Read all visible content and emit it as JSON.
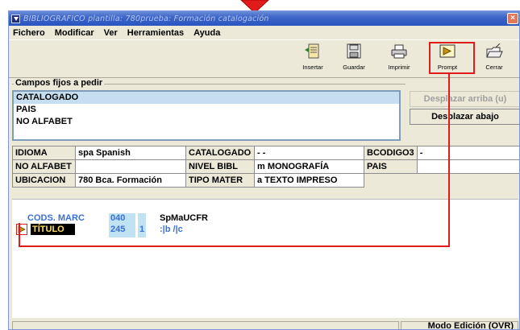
{
  "window": {
    "title": "BIBLIOGRAFICO plantilla: 780prueba: Formación catalogación"
  },
  "menu": [
    "Fichero",
    "Modificar",
    "Ver",
    "Herramientas",
    "Ayuda"
  ],
  "toolbar": {
    "buttons": [
      {
        "label": "Insertar",
        "icon": "insert-icon"
      },
      {
        "label": "Guardar",
        "icon": "save-icon"
      },
      {
        "label": "Imprimir",
        "icon": "print-icon"
      },
      {
        "label": "Prompt",
        "icon": "prompt-icon"
      },
      {
        "label": "Cerrar",
        "icon": "close-folder-icon"
      }
    ]
  },
  "campos": {
    "group_label": "Campos fijos a pedir",
    "items": [
      "CATALOGADO",
      "PAIS",
      "NO ALFABET"
    ],
    "selected": "CATALOGADO",
    "move_up": "Desplazar arriba (u)",
    "move_down": "Desplazar abajo"
  },
  "fixed_fields": [
    [
      {
        "label": "IDIOMA",
        "value": "spa  Spanish"
      },
      {
        "label": "CATALOGADO",
        "value": "- -"
      },
      {
        "label": "BCODIGO3",
        "value": "-"
      }
    ],
    [
      {
        "label": "NO ALFABET",
        "value": ""
      },
      {
        "label": "NIVEL BIBL",
        "value": "m  MONOGRAFÍA"
      },
      {
        "label": "PAIS",
        "value": ""
      }
    ],
    [
      {
        "label": "UBICACION",
        "value": "780   Bca. Formación"
      },
      {
        "label": "TIPO MATER",
        "value": "a  TEXTO IMPRESO"
      }
    ]
  ],
  "marc": {
    "rows": [
      {
        "label": "CODS. MARC",
        "tag": "040",
        "ind": "",
        "content": "SpMaUCFR"
      },
      {
        "label": "TÍTULO",
        "tag": "245",
        "ind": "1",
        "content": ":|b /|c"
      }
    ]
  },
  "status": {
    "mode": "Modo Edición (OVR)"
  },
  "colors": {
    "highlight": "#e01b1b",
    "selected_row": "#c5dff0",
    "marc_label": "#3a6fd8",
    "titulo_text": "#ffe25a"
  }
}
